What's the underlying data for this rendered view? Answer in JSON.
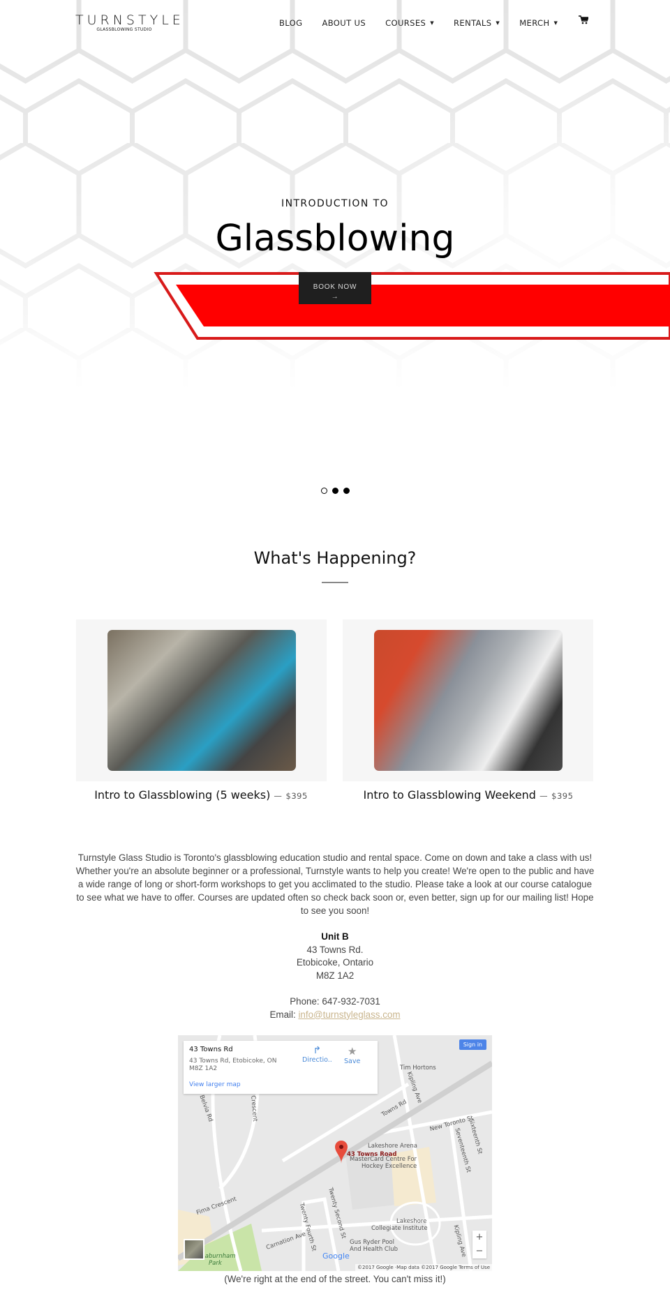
{
  "header": {
    "logo": "TURNSTYLE",
    "logo_sub": "GLASSBLOWING STUDIO",
    "nav": [
      {
        "label": "BLOG",
        "dropdown": false
      },
      {
        "label": "ABOUT US",
        "dropdown": false
      },
      {
        "label": "COURSES",
        "dropdown": true
      },
      {
        "label": "RENTALS",
        "dropdown": true
      },
      {
        "label": "MERCH",
        "dropdown": true
      }
    ],
    "cart_icon": "cart-icon"
  },
  "hero": {
    "eyebrow": "INTRODUCTION TO",
    "title": "Glassblowing",
    "button": "BOOK NOW",
    "button_arrow": "→",
    "slides": 3,
    "active_slide": 1,
    "banner_color": "#ff0000"
  },
  "happening": {
    "title": "What's Happening?",
    "products": [
      {
        "title": "Intro to Glassblowing (5 weeks)",
        "sep": "—",
        "price": "$395"
      },
      {
        "title": "Intro to Glassblowing Weekend",
        "sep": "—",
        "price": "$395"
      }
    ]
  },
  "about": {
    "text": "Turnstyle Glass Studio is Toronto's glassblowing education studio and rental space. Come on down and take a class with us!  Whether you're an absolute beginner or a professional, Turnstyle wants to help you create!  We're open to the public and have a wide range of long or short-form workshops to get you acclimated to the studio. Please take a look at our course catalogue to see what we have to offer. Courses are updated often so check back soon or, even better, sign up for our mailing list! Hope to see you soon!",
    "unit": "Unit B",
    "street": "43 Towns Rd.",
    "city": "Etobicoke, Ontario",
    "postal": "M8Z 1A2",
    "phone_label": "Phone:",
    "phone": "647-932-7031",
    "email_label": "Email:",
    "email": "info@turnstyleglass.com"
  },
  "map": {
    "place": "43 Towns Rd",
    "address": "43 Towns Rd, Etobicoke, ON M8Z 1A2",
    "directions": "Directio..",
    "save": "Save",
    "larger": "View larger map",
    "sign_in": "Sign in",
    "pin_label": "43 Towns Road",
    "labels": [
      "Tim Hortons",
      "Towns Rd",
      "Kipling Ave",
      "New Toronto St",
      "Seventeenth St",
      "Sixteenth St",
      "Belvia Rd",
      "Crescent",
      "Lakeshore Arena",
      "MasterCard Centre For",
      "Hockey Excellence",
      "Fima Crescent",
      "Twenty Second St",
      "Twenty Fourth St",
      "Carnation Ave",
      "Lakeshore",
      "Collegiate Institute",
      "Gus Ryder Pool",
      "And Health Club",
      "Laburnham",
      "Park",
      "Kipling Ave"
    ],
    "google": "Google",
    "attribution": "©2017 Google ·Map data ©2017 Google",
    "terms": "Terms of Use",
    "zoom_in": "+",
    "zoom_out": "−"
  },
  "caption": "(We're right at the end of the street.  You can't miss it!)"
}
